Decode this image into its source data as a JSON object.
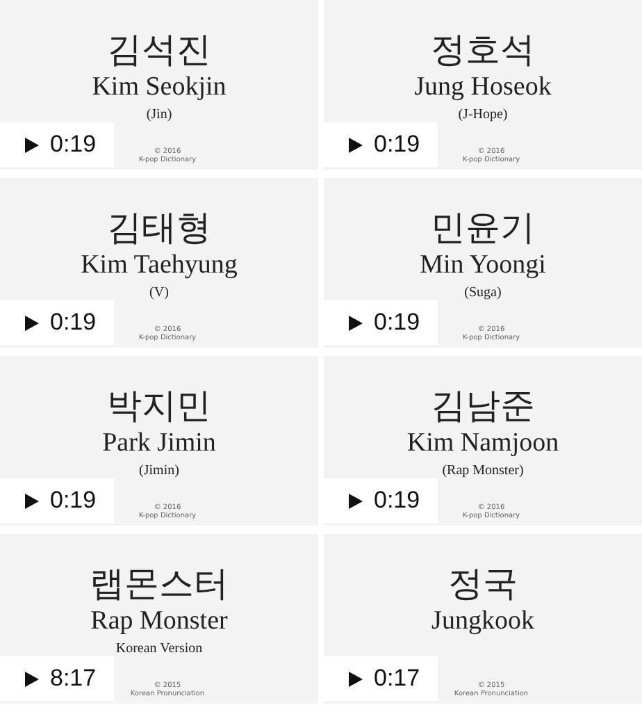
{
  "videos": [
    {
      "korean": "김석진",
      "name": "Kim Seokjin",
      "subtitle": "(Jin)",
      "copyright": "© 2016",
      "channel": "K-pop Dictionary",
      "duration": "0:19"
    },
    {
      "korean": "정호석",
      "name": "Jung Hoseok",
      "subtitle": "(J-Hope)",
      "copyright": "© 2016",
      "channel": "K-pop Dictionary",
      "duration": "0:19"
    },
    {
      "korean": "김태형",
      "name": "Kim Taehyung",
      "subtitle": "(V)",
      "copyright": "© 2016",
      "channel": "K-pop Dictionary",
      "duration": "0:19"
    },
    {
      "korean": "민윤기",
      "name": "Min Yoongi",
      "subtitle": "(Suga)",
      "copyright": "© 2016",
      "channel": "K-pop Dictionary",
      "duration": "0:19"
    },
    {
      "korean": "박지민",
      "name": "Park Jimin",
      "subtitle": "(Jimin)",
      "copyright": "© 2016",
      "channel": "K-pop Dictionary",
      "duration": "0:19"
    },
    {
      "korean": "김남준",
      "name": "Kim Namjoon",
      "subtitle": "(Rap Monster)",
      "copyright": "© 2016",
      "channel": "K-pop Dictionary",
      "duration": "0:19"
    },
    {
      "korean": "랩몬스터",
      "name": "Rap Monster",
      "subtitle": "Korean Version",
      "copyright": "© 2015",
      "channel": "Korean Pronunciation",
      "duration": "8:17"
    },
    {
      "korean": "정국",
      "name": "Jungkook",
      "copyright": "© 2015",
      "channel": "Korean Pronunciation",
      "duration": "0:17"
    }
  ]
}
